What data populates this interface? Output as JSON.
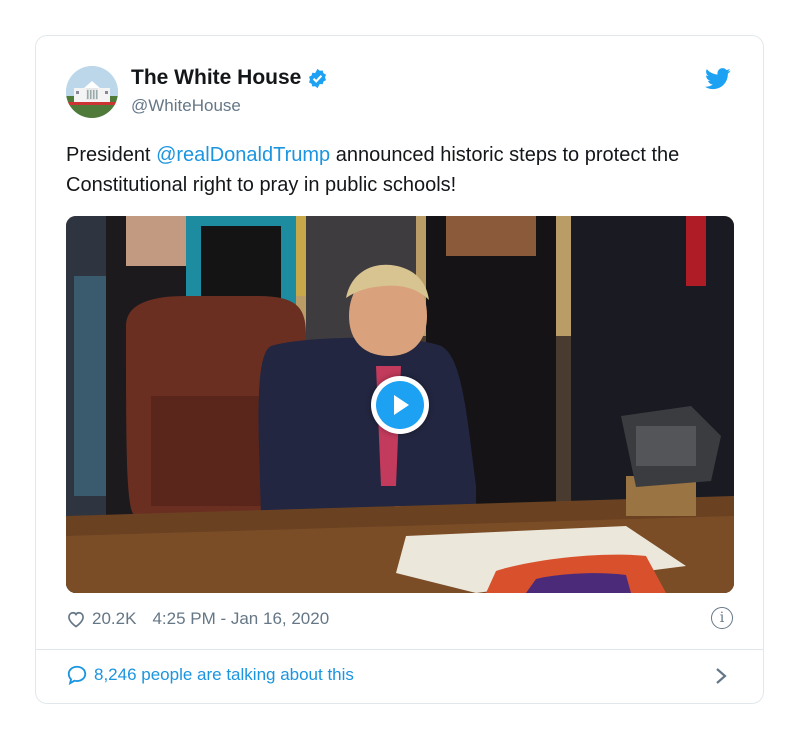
{
  "author": {
    "display_name": "The White House",
    "handle": "@WhiteHouse",
    "verified": true
  },
  "tweet": {
    "text_before": "President ",
    "mention": "@realDonaldTrump",
    "text_after": " announced historic steps to protect the Constitutional right to pray in public schools!"
  },
  "media": {
    "type": "video",
    "play_icon": "play-icon"
  },
  "footer": {
    "like_count": "20.2K",
    "timestamp": "4:25 PM - Jan 16, 2020",
    "talking": "8,246 people are talking about this"
  },
  "icons": {
    "brand": "twitter-bird-icon",
    "verified": "verified-badge-icon",
    "like": "heart-icon",
    "info": "info-icon",
    "reply": "comment-bubble-icon",
    "more": "chevron-right-icon"
  },
  "colors": {
    "accent": "#1da1f2",
    "link": "#1b95e0",
    "muted": "#657786"
  }
}
